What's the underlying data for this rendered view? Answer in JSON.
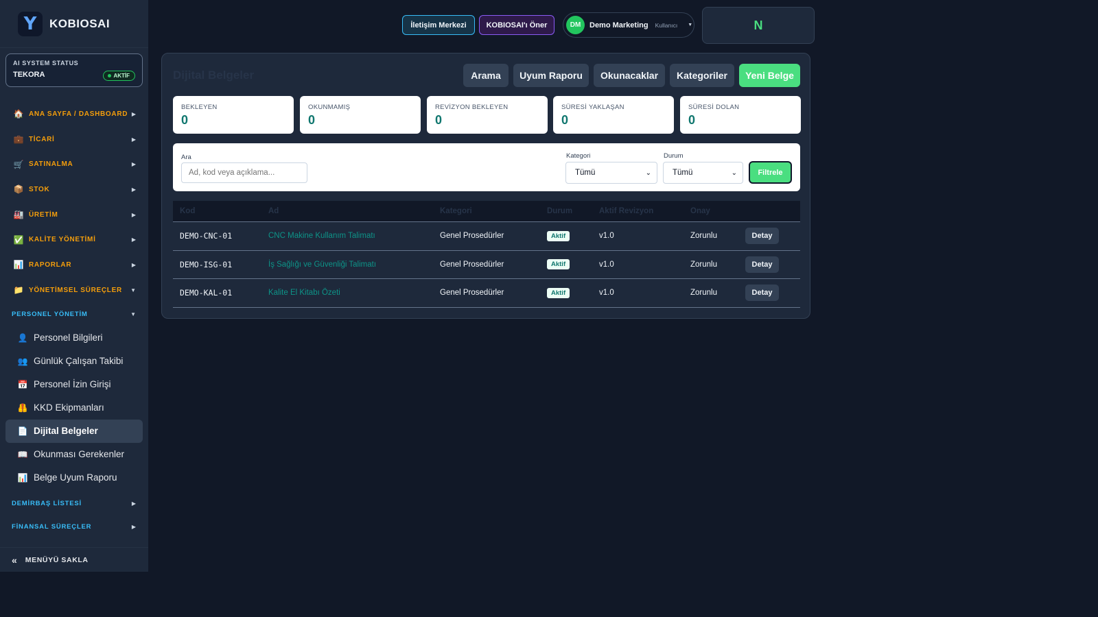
{
  "brand": {
    "logo_letter": "Y",
    "name": "KOBIOSAI"
  },
  "ai_status": {
    "title": "AI SYSTEM STATUS",
    "name": "TEKORA",
    "badge": "AKTİF"
  },
  "nav": {
    "items": [
      {
        "icon": "🏠",
        "label": "ANA SAYFA / DASHBOARD",
        "arrow": "▶"
      },
      {
        "icon": "💼",
        "label": "TİCARİ",
        "arrow": "▶"
      },
      {
        "icon": "🛒",
        "label": "SATINALMA",
        "arrow": "▶"
      },
      {
        "icon": "📦",
        "label": "STOK",
        "arrow": "▶"
      },
      {
        "icon": "🏭",
        "label": "ÜRETİM",
        "arrow": "▶"
      },
      {
        "icon": "✅",
        "label": "KALİTE YÖNETİMİ",
        "arrow": "▶"
      },
      {
        "icon": "📊",
        "label": "RAPORLAR",
        "arrow": "▶"
      },
      {
        "icon": "📁",
        "label": "YÖNETİMSEL SÜREÇLER",
        "arrow": "▼"
      }
    ],
    "personnel_section": {
      "label": "PERSONEL YÖNETİM",
      "arrow": "▼"
    },
    "personnel_items": [
      {
        "icon": "👤",
        "label": "Personel Bilgileri"
      },
      {
        "icon": "👥",
        "label": "Günlük Çalışan Takibi"
      },
      {
        "icon": "📅",
        "label": "Personel İzin Girişi"
      },
      {
        "icon": "🦺",
        "label": "KKD Ekipmanları"
      },
      {
        "icon": "📄",
        "label": "Dijital Belgeler"
      },
      {
        "icon": "📖",
        "label": "Okunması Gerekenler"
      },
      {
        "icon": "📊",
        "label": "Belge Uyum Raporu"
      }
    ],
    "fixtures_section": {
      "label": "DEMİRBAŞ LİSTESİ",
      "arrow": "▶"
    },
    "finance_section": {
      "label": "FİNANSAL SÜREÇLER",
      "arrow": "▶"
    },
    "hide_menu": {
      "icon": "«",
      "label": "MENÜYÜ SAKLA"
    }
  },
  "topbar": {
    "contact_label": "İletişim Merkezi",
    "suggest_label": "KOBIOSAI'ı Öner",
    "user": {
      "initials": "DM",
      "name": "Demo Marketing",
      "role": "Kullanıcı",
      "caret": "▼"
    },
    "n_label": "N"
  },
  "page": {
    "title": "Dijital Belgeler",
    "actions": {
      "search": "Arama",
      "compliance": "Uyum Raporu",
      "readers": "Okunacaklar",
      "categories": "Kategoriler",
      "new_doc": "Yeni Belge"
    },
    "stats": [
      {
        "label": "BEKLEYEN",
        "value": "0"
      },
      {
        "label": "OKUNMAMIŞ",
        "value": "0"
      },
      {
        "label": "REVİZYON BEKLEYEN",
        "value": "0"
      },
      {
        "label": "SÜRESİ YAKLAŞAN",
        "value": "0"
      },
      {
        "label": "SÜRESİ DOLAN",
        "value": "0"
      }
    ],
    "filters": {
      "search_label": "Ara",
      "search_placeholder": "Ad, kod veya açıklama...",
      "category_label": "Kategori",
      "category_value": "Tümü",
      "status_label": "Durum",
      "status_value": "Tümü",
      "filter_button": "Filtrele"
    },
    "table": {
      "headers": {
        "code": "Kod",
        "name": "Ad",
        "category": "Kategori",
        "status": "Durum",
        "revision": "Aktif Revizyon",
        "approval": "Onay"
      },
      "rows": [
        {
          "code": "DEMO-CNC-01",
          "name": "CNC Makine Kullanım Talimatı",
          "category": "Genel Prosedürler",
          "status": "Aktif",
          "revision": "v1.0",
          "approval": "Zorunlu",
          "action": "Detay"
        },
        {
          "code": "DEMO-ISG-01",
          "name": "İş Sağlığı ve Güvenliği Talimatı",
          "category": "Genel Prosedürler",
          "status": "Aktif",
          "revision": "v1.0",
          "approval": "Zorunlu",
          "action": "Detay"
        },
        {
          "code": "DEMO-KAL-01",
          "name": "Kalite El Kitabı Özeti",
          "category": "Genel Prosedürler",
          "status": "Aktif",
          "revision": "v1.0",
          "approval": "Zorunlu",
          "action": "Detay"
        }
      ]
    }
  }
}
